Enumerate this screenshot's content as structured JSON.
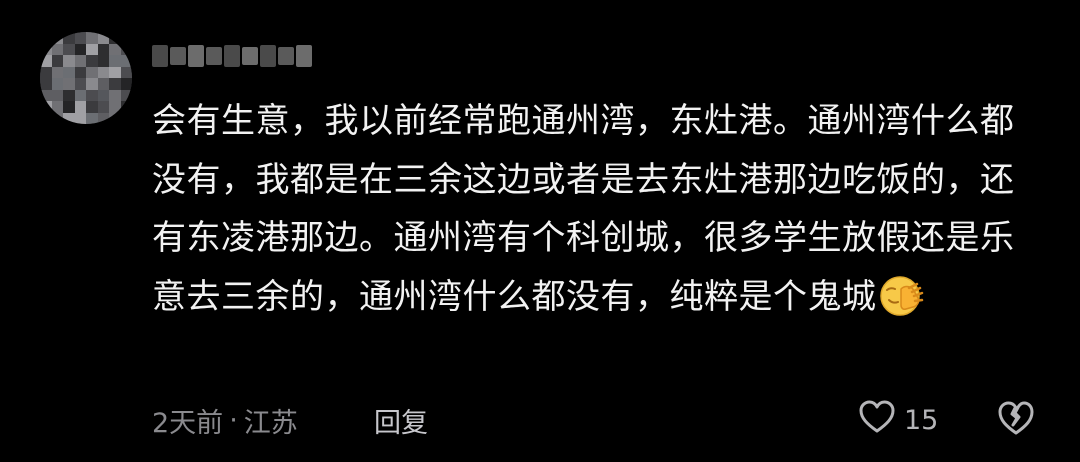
{
  "comment": {
    "text": "会有生意，我以前经常跑通州湾，东灶港。通州湾什么都没有，我都是在三余这边或者是去东灶港那边吃饭的，还有东凌港那边。通州湾有个科创城，很多学生放假还是乐意去三余的，通州湾什么都没有，纯粹是个鬼城",
    "emoji": "face-palm-emoji",
    "time": "2天前",
    "separator": "·",
    "location": "江苏",
    "reply_label": "回复",
    "like_count": "15"
  },
  "icons": {
    "like": "heart-outline-icon",
    "dislike": "broken-heart-icon"
  },
  "colors": {
    "background": "#000000",
    "text": "#f2f2f2",
    "meta": "#8a8a8e",
    "reply": "#c7c7cc",
    "icon": "#b5b5b8",
    "emoji": "#f7c948"
  }
}
